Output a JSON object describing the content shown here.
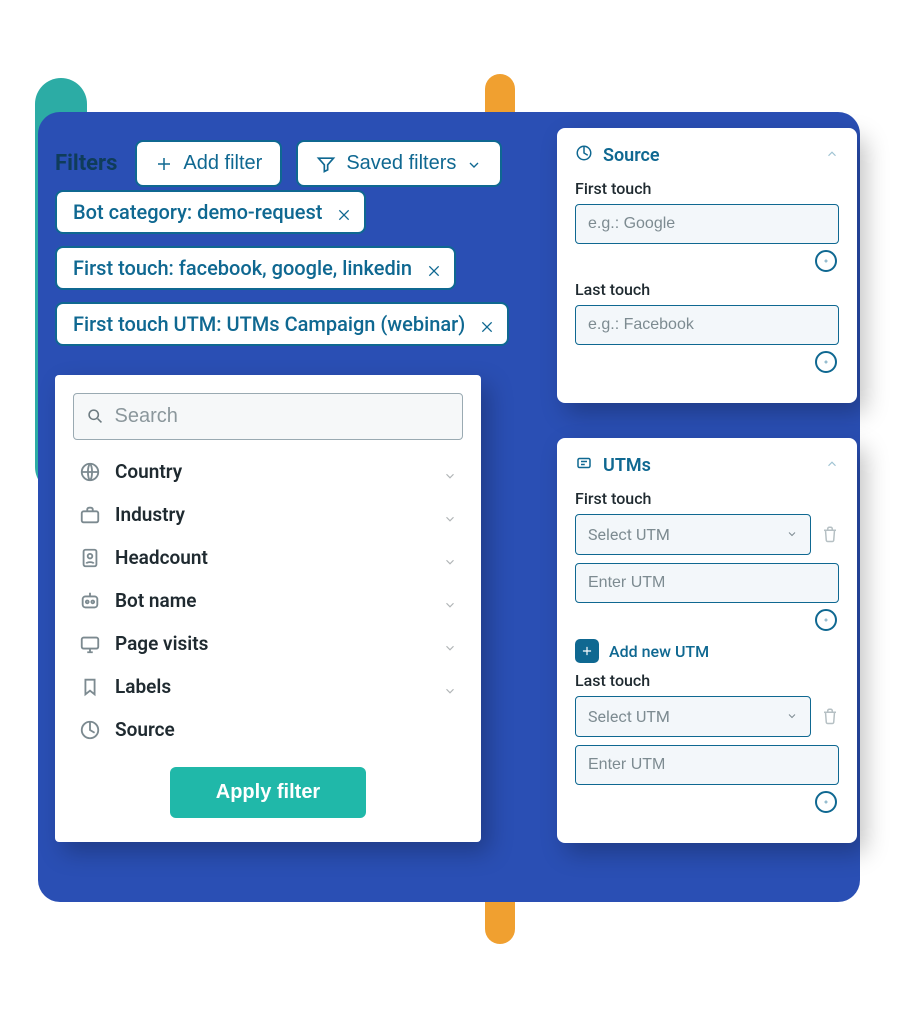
{
  "filters": {
    "title": "Filters",
    "add_label": "Add filter",
    "saved_label": "Saved filters",
    "applied": [
      "Bot category: demo-request",
      "First touch: facebook, google, linkedin",
      "First touch UTM: UTMs Campaign (webinar)"
    ]
  },
  "builder": {
    "search_placeholder": "Search",
    "rows": [
      {
        "label": "Country",
        "icon": "globe"
      },
      {
        "label": "Industry",
        "icon": "briefcase"
      },
      {
        "label": "Headcount",
        "icon": "badge"
      },
      {
        "label": "Bot name",
        "icon": "bot"
      },
      {
        "label": "Page visits",
        "icon": "monitor"
      },
      {
        "label": "Labels",
        "icon": "bookmark"
      },
      {
        "label": "Source",
        "icon": "source"
      }
    ],
    "apply_label": "Apply filter"
  },
  "source_card": {
    "title": "Source",
    "first_touch_label": "First touch",
    "first_touch_ph": "e.g.: Google",
    "last_touch_label": "Last touch",
    "last_touch_ph": "e.g.: Facebook"
  },
  "utm_card": {
    "title": "UTMs",
    "first_touch_label": "First touch",
    "select_ph": "Select UTM",
    "enter_ph": "Enter UTM",
    "add_new_label": "Add new UTM",
    "last_touch_label": "Last touch"
  }
}
